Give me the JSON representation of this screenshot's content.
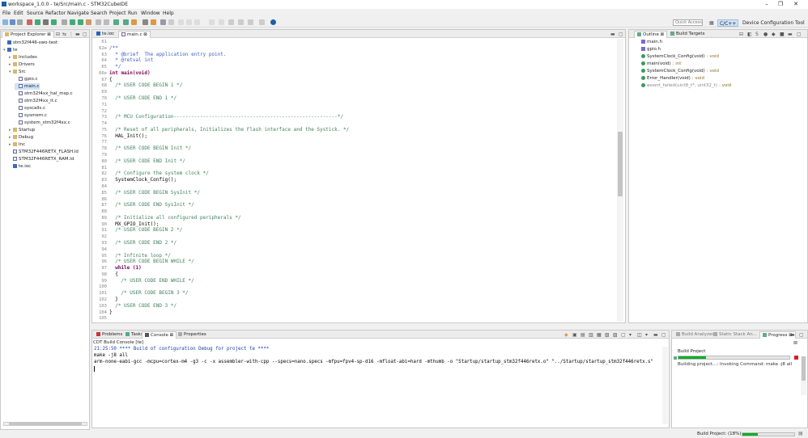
{
  "window": {
    "title": "workspace_1.0.0 - te/Src/main.c - STM32CubeIDE"
  },
  "menu": [
    "File",
    "Edit",
    "Source",
    "Refactor",
    "Navigate",
    "Search",
    "Project",
    "Run",
    "Window",
    "Help"
  ],
  "toolbar": {
    "quick_access": "Quick Access",
    "perspective_cc": "C/C++",
    "perspective_dct": "Device Configuration Tool"
  },
  "explorer": {
    "title": "Project Explorer",
    "items": [
      {
        "label": "stm32f446-swo-test",
        "type": "proj"
      },
      {
        "label": "te",
        "type": "proj"
      },
      {
        "label": "Includes",
        "type": "folder"
      },
      {
        "label": "Drivers",
        "type": "folder"
      },
      {
        "label": "Src",
        "type": "folder"
      },
      {
        "label": "gpio.c",
        "type": "c"
      },
      {
        "label": "main.c",
        "type": "c"
      },
      {
        "label": "stm32f4xx_hal_msp.c",
        "type": "c"
      },
      {
        "label": "stm32f4xx_it.c",
        "type": "c"
      },
      {
        "label": "syscalls.c",
        "type": "c"
      },
      {
        "label": "sysmem.c",
        "type": "c"
      },
      {
        "label": "system_stm32f4xx.c",
        "type": "c"
      },
      {
        "label": "Startup",
        "type": "folder"
      },
      {
        "label": "Debug",
        "type": "folder"
      },
      {
        "label": "Inc",
        "type": "folder"
      },
      {
        "label": "STM32F446RETX_FLASH.ld",
        "type": "ld"
      },
      {
        "label": "STM32F446RETX_RAM.ld",
        "type": "ld"
      },
      {
        "label": "te.ioc",
        "type": "ioc"
      }
    ]
  },
  "editor": {
    "tabs": [
      "te.ioc",
      "main.c"
    ],
    "lines": [
      {
        "n": "61",
        "t": "",
        "c": "plain"
      },
      {
        "n": "62⊖",
        "t": "/**",
        "c": "doc"
      },
      {
        "n": "63",
        "t": "  * @brief  The application entry point.",
        "c": "doc"
      },
      {
        "n": "64",
        "t": "  * @retval int",
        "c": "doc"
      },
      {
        "n": "65",
        "t": "  */",
        "c": "doc"
      },
      {
        "n": "66⊖",
        "t": "int main(void)",
        "c": "kw"
      },
      {
        "n": "67",
        "t": "{",
        "c": "plain"
      },
      {
        "n": "68",
        "t": "  /* USER CODE BEGIN 1 */",
        "c": "comment"
      },
      {
        "n": "69",
        "t": "",
        "c": "plain"
      },
      {
        "n": "70",
        "t": "  /* USER CODE END 1 */",
        "c": "comment"
      },
      {
        "n": "71",
        "t": "",
        "c": "plain"
      },
      {
        "n": "72",
        "t": "",
        "c": "plain"
      },
      {
        "n": "73",
        "t": "  /* MCU Configuration--------------------------------------------------------*/",
        "c": "comment"
      },
      {
        "n": "74",
        "t": "",
        "c": "plain"
      },
      {
        "n": "75",
        "t": "  /* Reset of all peripherals, Initializes the Flash interface and the Systick. */",
        "c": "comment"
      },
      {
        "n": "76",
        "t": "  HAL_Init();",
        "c": "plain"
      },
      {
        "n": "77",
        "t": "",
        "c": "plain"
      },
      {
        "n": "78",
        "t": "  /* USER CODE BEGIN Init */",
        "c": "comment"
      },
      {
        "n": "79",
        "t": "",
        "c": "plain"
      },
      {
        "n": "80",
        "t": "  /* USER CODE END Init */",
        "c": "comment"
      },
      {
        "n": "81",
        "t": "",
        "c": "plain"
      },
      {
        "n": "82",
        "t": "  /* Configure the system clock */",
        "c": "comment"
      },
      {
        "n": "83",
        "t": "  SystemClock_Config();",
        "c": "plain"
      },
      {
        "n": "84",
        "t": "",
        "c": "plain"
      },
      {
        "n": "85",
        "t": "  /* USER CODE BEGIN SysInit */",
        "c": "comment"
      },
      {
        "n": "86",
        "t": "",
        "c": "plain"
      },
      {
        "n": "87",
        "t": "  /* USER CODE END SysInit */",
        "c": "comment"
      },
      {
        "n": "88",
        "t": "",
        "c": "plain"
      },
      {
        "n": "89",
        "t": "  /* Initialize all configured peripherals */",
        "c": "comment"
      },
      {
        "n": "90",
        "t": "  MX_GPIO_Init();",
        "c": "plain"
      },
      {
        "n": "91",
        "t": "  /* USER CODE BEGIN 2 */",
        "c": "comment"
      },
      {
        "n": "92",
        "t": "",
        "c": "plain"
      },
      {
        "n": "93",
        "t": "  /* USER CODE END 2 */",
        "c": "comment"
      },
      {
        "n": "94",
        "t": "",
        "c": "plain"
      },
      {
        "n": "95",
        "t": "  /* Infinite loop */",
        "c": "comment"
      },
      {
        "n": "96",
        "t": "  /* USER CODE BEGIN WHILE */",
        "c": "comment"
      },
      {
        "n": "97",
        "t": "  while (1)",
        "c": "kw"
      },
      {
        "n": "98",
        "t": "  {",
        "c": "plain"
      },
      {
        "n": "99",
        "t": "    /* USER CODE END WHILE */",
        "c": "comment"
      },
      {
        "n": "100",
        "t": "",
        "c": "plain"
      },
      {
        "n": "101",
        "t": "    /* USER CODE BEGIN 3 */",
        "c": "comment"
      },
      {
        "n": "102",
        "t": "  }",
        "c": "plain"
      },
      {
        "n": "103",
        "t": "  /* USER CODE END 3 */",
        "c": "comment"
      },
      {
        "n": "104",
        "t": "}",
        "c": "plain"
      },
      {
        "n": "105",
        "t": "",
        "c": "plain"
      }
    ]
  },
  "outline": {
    "tabs": [
      "Outline",
      "Build Targets"
    ],
    "items": [
      {
        "label": "main.h",
        "type": ""
      },
      {
        "label": "gpio.h",
        "type": ""
      },
      {
        "label": "SystemClock_Config(void)",
        "type": ": void"
      },
      {
        "label": "main(void)",
        "type": ": int"
      },
      {
        "label": "SystemClock_Config(void)",
        "type": ": void"
      },
      {
        "label": "Error_Handler(void)",
        "type": ": void"
      },
      {
        "label": "assert_failed(uint8_t*, uint32_t)",
        "type": ": void"
      }
    ]
  },
  "bottom": {
    "tabs": [
      "Problems",
      "Tasks",
      "Console",
      "Properties"
    ],
    "console_title": "CDT Build Console [te]",
    "lines": [
      "21:25:50 **** Build of configuration Debug for project te ****",
      "make -j8 all",
      "arm-none-eabi-gcc -mcpu=cortex-m4 -g3 -c -x assembler-with-cpp --specs=nano.specs -mfpu=fpv4-sp-d16 -mfloat-abi=hard -mthumb -o \"Startup/startup_stm32f446retx.o\" \"../Startup/startup_stm32f446retx.s\""
    ]
  },
  "progress": {
    "tabs": [
      "Build Analyzer",
      "Static Stack An...",
      "Progress"
    ],
    "job": "Build Project",
    "detail": "Building project...: Invoking Command: make -j8 all",
    "fraction": 0.18
  },
  "status": {
    "text": "Build Project: (18%)",
    "fraction": 0.18
  },
  "colors": {
    "progress_green": "#06b025",
    "selection": "#cfe2f7"
  }
}
